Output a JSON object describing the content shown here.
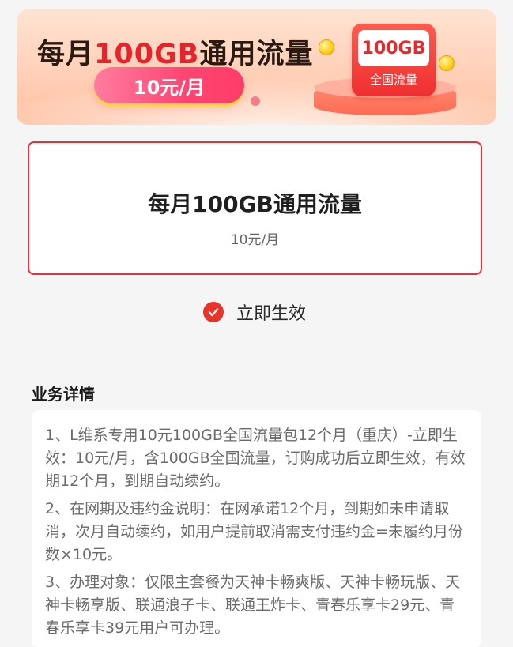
{
  "banner": {
    "title_prefix": "每月",
    "title_highlight": "100GB",
    "title_suffix": "通用流量",
    "price_pill": "10元/月",
    "badge_value": "100GB",
    "badge_label": "全国流量"
  },
  "product_card": {
    "title": "每月100GB通用流量",
    "price": "10元/月"
  },
  "effective": {
    "label": "立即生效",
    "checked": true
  },
  "details": {
    "title": "业务详情",
    "paragraphs": [
      "1、L维系专用10元100GB全国流量包12个月（重庆）-立即生效：10元/月，含100GB全国流量，订购成功后立即生效，有效期12个月，到期自动续约。",
      "2、在网期及违约金说明：在网承诺12个月，到期如未申请取消，次月自动续约，如用户提前取消需支付违约金=未履约月份数×10元。",
      "3、办理对象：仅限主套餐为天神卡畅爽版、天神卡畅玩版、天神卡畅享版、联通浪子卡、联通王炸卡、青春乐享卡29元、青春乐享卡39元用户可办理。"
    ]
  },
  "colors": {
    "accent_red": "#e8323a",
    "pill_pink": "#ff4573",
    "page_bg": "#f5f5f5"
  }
}
